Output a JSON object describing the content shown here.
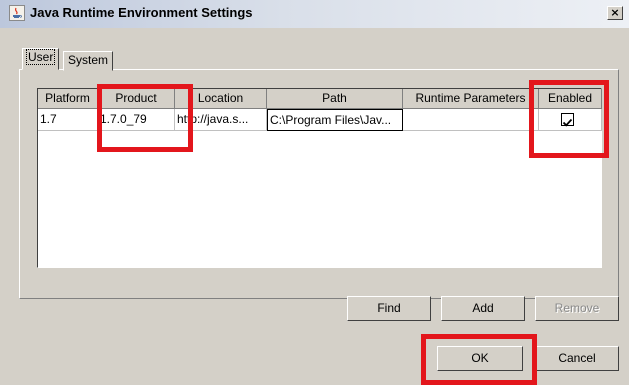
{
  "window": {
    "title": "Java Runtime Environment Settings",
    "close_label": "×"
  },
  "tabs": [
    {
      "label": "User",
      "active": true
    },
    {
      "label": "System",
      "active": false
    }
  ],
  "table": {
    "columns": [
      "Platform",
      "Product",
      "Location",
      "Path",
      "Runtime Parameters",
      "Enabled"
    ],
    "rows": [
      {
        "platform": "1.7",
        "product": "1.7.0_79",
        "location": "http://java.s...",
        "path": "C:\\Program Files\\Jav...",
        "runtime_parameters": "",
        "enabled": true
      }
    ]
  },
  "buttons": {
    "find": "Find",
    "add": "Add",
    "remove": "Remove",
    "ok": "OK",
    "cancel": "Cancel"
  },
  "colors": {
    "highlight_box": "#e3161c",
    "window_bg": "#d4d0c8"
  }
}
